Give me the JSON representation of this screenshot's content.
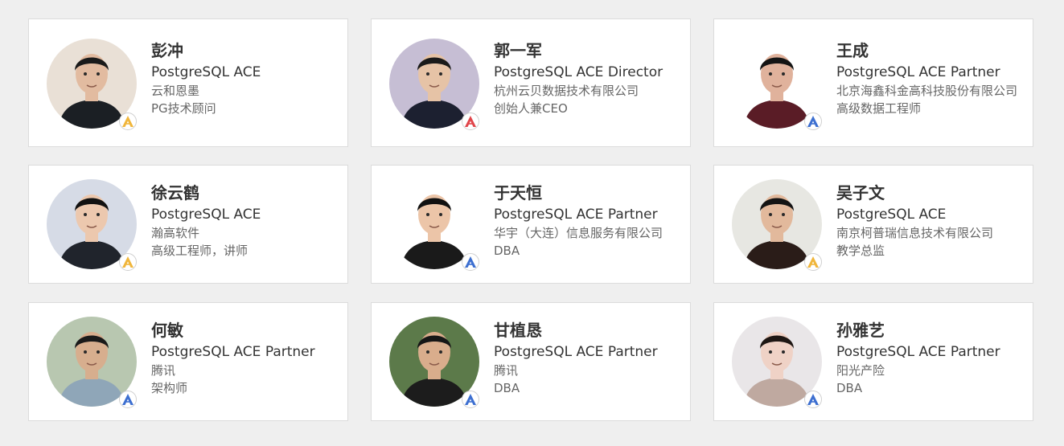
{
  "people": [
    {
      "name": "彭冲",
      "title": "PostgreSQL ACE",
      "company": "云和恩墨",
      "role": "PG技术顾问",
      "badge_color": "#f0b63c",
      "bg": "#e9e0d6",
      "skin": "#e2bba0",
      "cloth": "#1b1f24",
      "hair": "#1a1a1a"
    },
    {
      "name": "郭一军",
      "title": "PostgreSQL ACE Director",
      "company": "杭州云贝数据技术有限公司",
      "role": "创始人兼CEO",
      "badge_color": "#e0454a",
      "bg": "#c6bed4",
      "skin": "#e6c3a6",
      "cloth": "#1c2030",
      "hair": "#1a1a1a"
    },
    {
      "name": "王成",
      "title": "PostgreSQL ACE Partner",
      "company": "北京海鑫科金高科技股份有限公司",
      "role": "高级数据工程师",
      "badge_color": "#3d6fd0",
      "bg": "#ffffff",
      "skin": "#e0b29c",
      "cloth": "#5a1c26",
      "hair": "#141414"
    },
    {
      "name": "徐云鹤",
      "title": "PostgreSQL ACE",
      "company": "瀚高软件",
      "role": "高级工程师，讲师",
      "badge_color": "#f0b63c",
      "bg": "#d6dbe6",
      "skin": "#ecc8ae",
      "cloth": "#20242c",
      "hair": "#111111"
    },
    {
      "name": "于天恒",
      "title": "PostgreSQL ACE Partner",
      "company": "华宇（大连）信息服务有限公司",
      "role": "DBA",
      "badge_color": "#3d6fd0",
      "bg": "#ffffff",
      "skin": "#ecc5a8",
      "cloth": "#1a1a1a",
      "hair": "#111111"
    },
    {
      "name": "吴子文",
      "title": "PostgreSQL ACE",
      "company": "南京柯普瑞信息技术有限公司",
      "role": "教学总监",
      "badge_color": "#f0b63c",
      "bg": "#e7e7e2",
      "skin": "#e2b99c",
      "cloth": "#2a1c18",
      "hair": "#141414"
    },
    {
      "name": "何敏",
      "title": "PostgreSQL ACE Partner",
      "company": "腾讯",
      "role": "架构师",
      "badge_color": "#3d6fd0",
      "bg": "#b8c7b0",
      "skin": "#d7ae8e",
      "cloth": "#8fa6b8",
      "hair": "#1a1a1a"
    },
    {
      "name": "甘植恳",
      "title": "PostgreSQL ACE Partner",
      "company": "腾讯",
      "role": "DBA",
      "badge_color": "#3d6fd0",
      "bg": "#5c7a4a",
      "skin": "#d9ad8c",
      "cloth": "#1c1c1c",
      "hair": "#161616"
    },
    {
      "name": "孙雅艺",
      "title": "PostgreSQL ACE Partner",
      "company": "阳光产险",
      "role": "DBA",
      "badge_color": "#3d6fd0",
      "bg": "#e9e6e8",
      "skin": "#efd2c6",
      "cloth": "#bfa9a0",
      "hair": "#1e1714"
    }
  ]
}
